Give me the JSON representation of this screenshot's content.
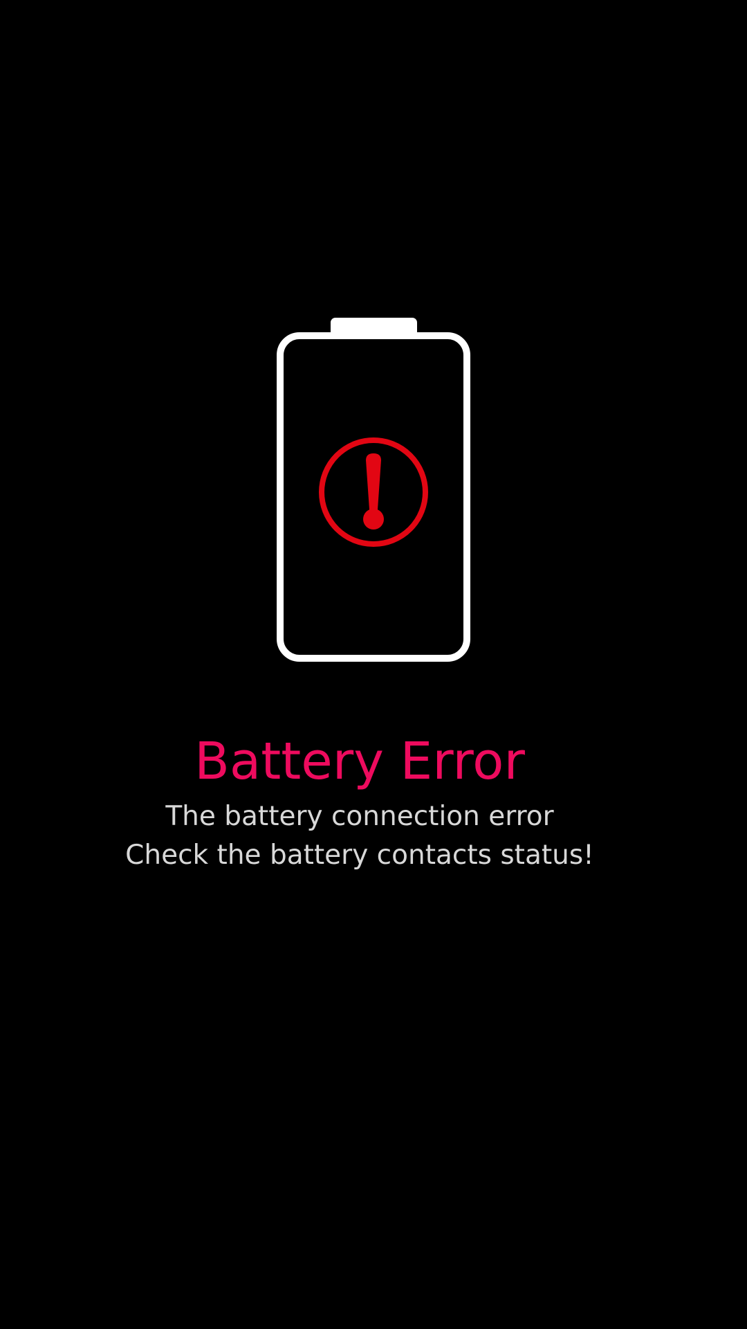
{
  "colors": {
    "background": "#000000",
    "battery_outline": "#ffffff",
    "error_icon": "#e20613",
    "title": "#ee0b5e",
    "message": "#d8d8d8"
  },
  "icons": {
    "battery": "battery-outline-icon",
    "alert": "exclamation-circle-icon"
  },
  "error": {
    "title": "Battery Error",
    "line1": "The battery connection error",
    "line2": "Check the battery contacts status!"
  }
}
